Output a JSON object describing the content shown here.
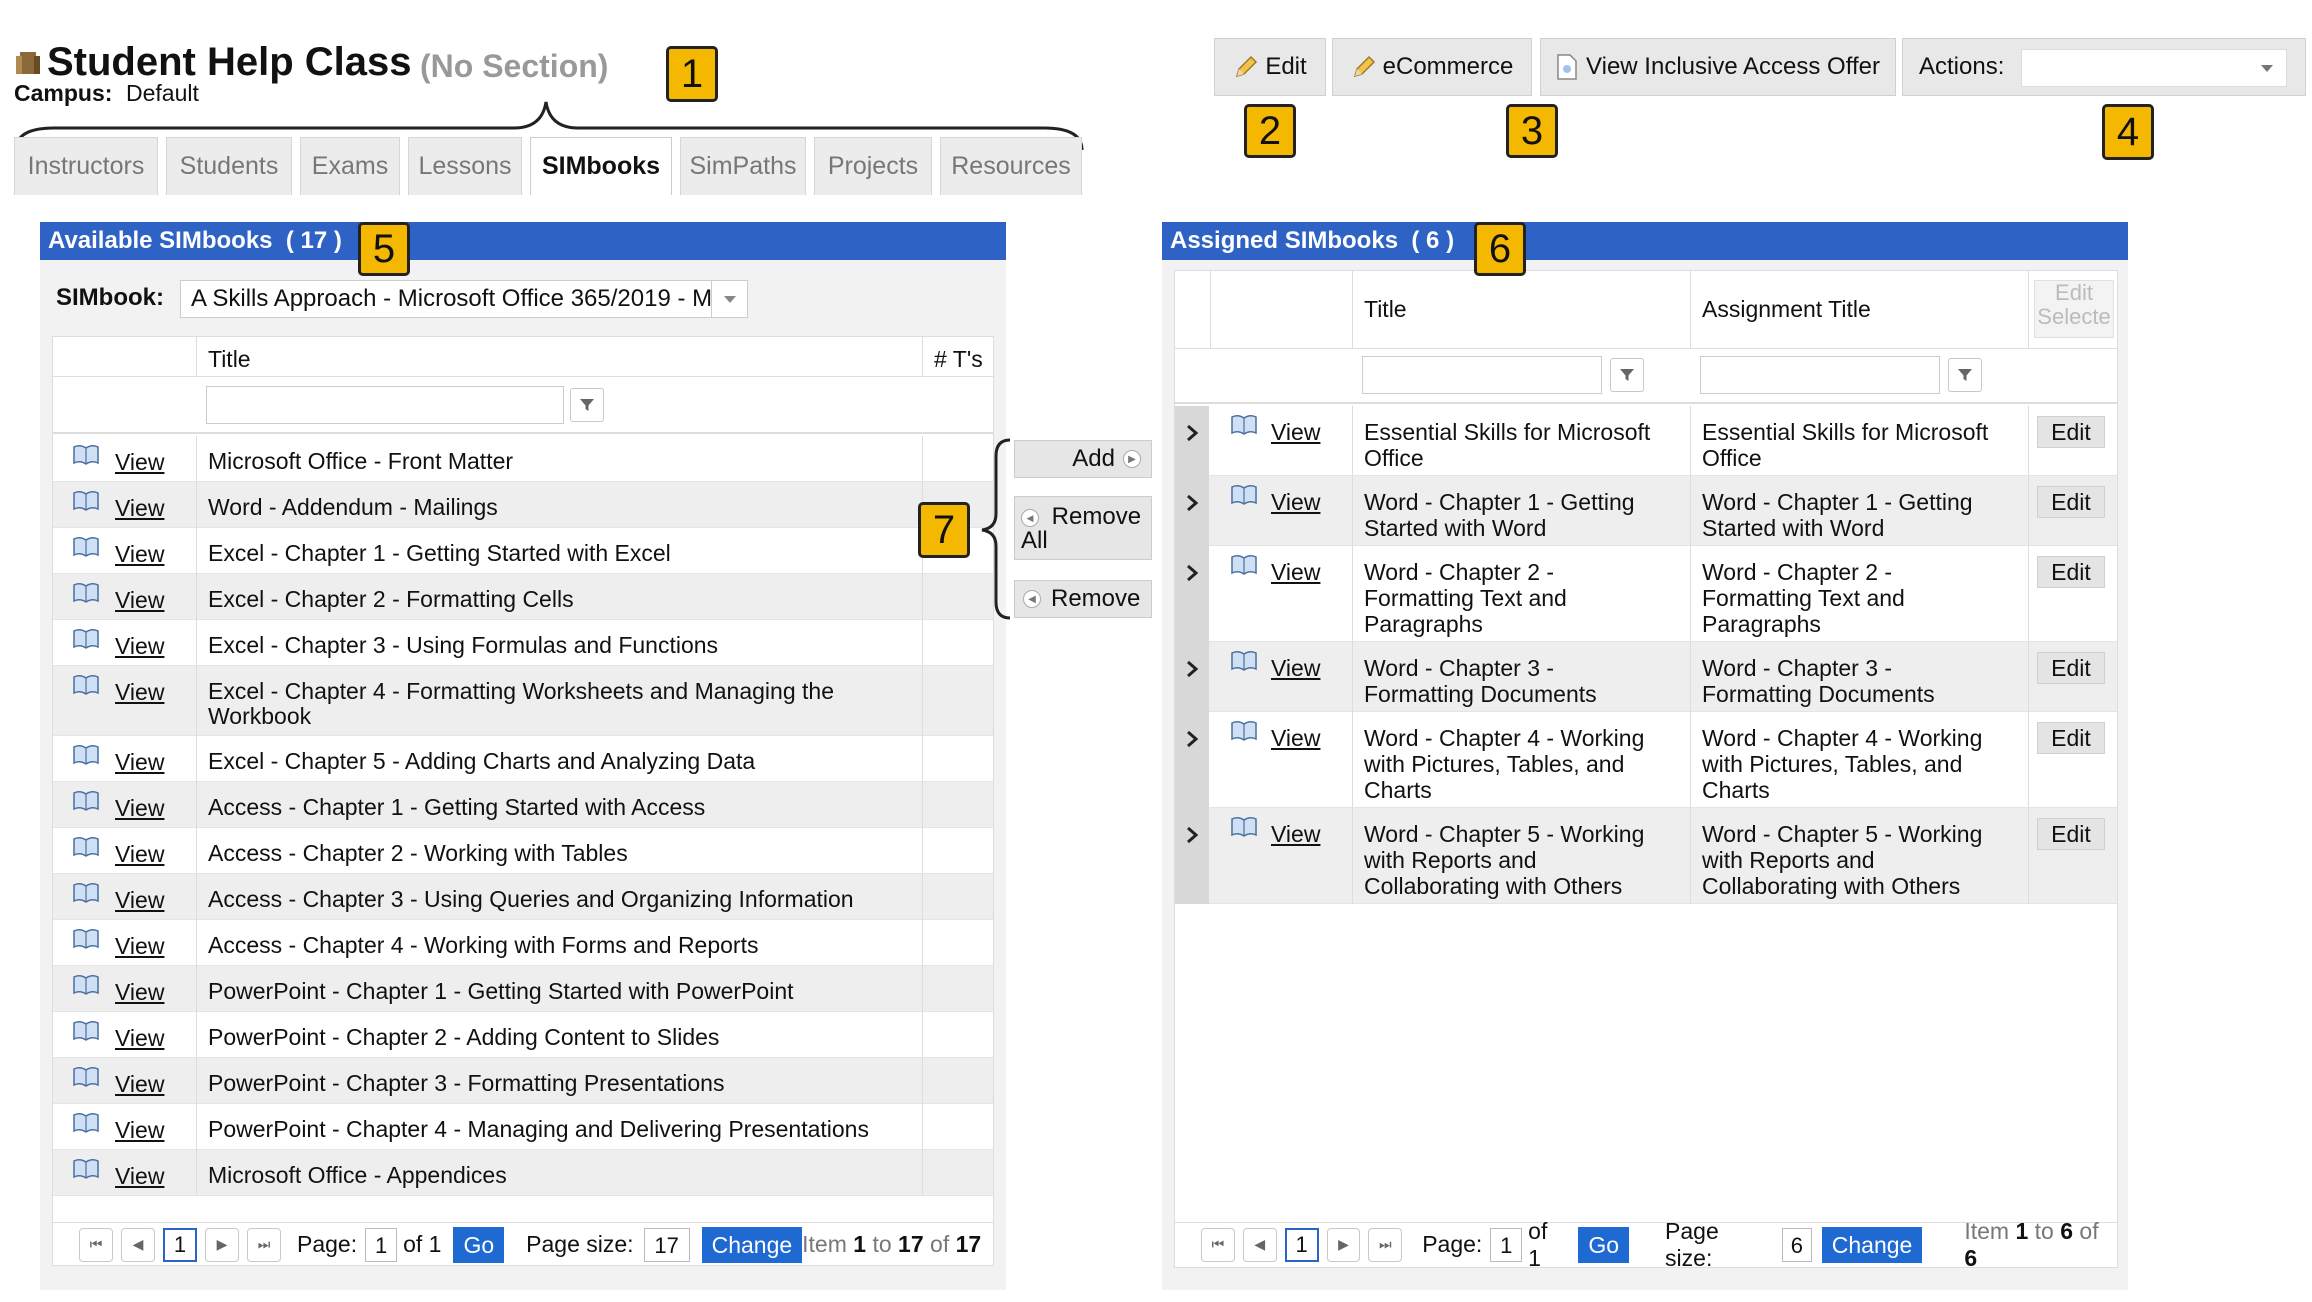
{
  "header": {
    "title": "Student Help Class",
    "section": "(No Section)",
    "campus_label": "Campus:",
    "campus_value": "Default"
  },
  "tabs": [
    {
      "label": "Instructors"
    },
    {
      "label": "Students"
    },
    {
      "label": "Exams"
    },
    {
      "label": "Lessons"
    },
    {
      "label": "SIMbooks",
      "active": true
    },
    {
      "label": "SimPaths"
    },
    {
      "label": "Projects"
    },
    {
      "label": "Resources"
    }
  ],
  "toolbar": {
    "edit_label": "Edit",
    "ecommerce_label": "eCommerce",
    "view_offer_label": "View Inclusive Access Offer",
    "actions_label": "Actions:",
    "actions_value": ""
  },
  "callouts": [
    "1",
    "2",
    "3",
    "4",
    "5",
    "6",
    "7"
  ],
  "available": {
    "header": "Available SIMbooks",
    "count": "( 17 )",
    "simbook_label": "SIMbook:",
    "simbook_value": "A Skills Approach -  Microsoft Office 365/2019 - M",
    "col_title": "Title",
    "col_ts": "# T's",
    "view_label": "View",
    "rows": [
      "Microsoft Office - Front Matter",
      "Word - Addendum - Mailings",
      "Excel - Chapter 1 - Getting Started with Excel",
      "Excel - Chapter 2 - Formatting Cells",
      "Excel - Chapter 3 - Using Formulas and Functions",
      "Excel - Chapter 4 - Formatting Worksheets and Managing the Workbook",
      "Excel - Chapter 5 - Adding Charts and Analyzing Data",
      "Access - Chapter 1 - Getting Started with Access",
      "Access - Chapter 2 - Working with Tables",
      "Access - Chapter 3 - Using Queries and Organizing Information",
      "Access - Chapter 4 - Working with Forms and Reports",
      "PowerPoint - Chapter 1 - Getting Started with PowerPoint",
      "PowerPoint - Chapter 2 - Adding Content to Slides",
      "PowerPoint - Chapter 3 - Formatting Presentations",
      "PowerPoint - Chapter 4 - Managing and Delivering Presentations",
      "Microsoft Office - Appendices"
    ],
    "pager": {
      "current": "1",
      "page_label": "Page:",
      "page_value": "1",
      "of_label": "of 1",
      "go": "Go",
      "size_label": "Page size:",
      "size_value": "17",
      "change": "Change",
      "item_prefix": "Item",
      "item_from": "1",
      "item_to_label": "to",
      "item_to": "17",
      "item_of_label": "of",
      "item_total": "17"
    }
  },
  "transfer": {
    "add": "Add",
    "remove_all_1": "Remove",
    "remove_all_2": "All",
    "remove": "Remove"
  },
  "assigned": {
    "header": "Assigned SIMbooks",
    "count": "( 6 )",
    "col_title": "Title",
    "col_assignment": "Assignment Title",
    "col_edit_1": "Edit",
    "col_edit_2": "Selecte",
    "view_label": "View",
    "edit_label": "Edit",
    "rows": [
      {
        "title": [
          "Essential Skills for Microsoft",
          "Office"
        ],
        "assignment": [
          "Essential Skills for Microsoft",
          "Office"
        ]
      },
      {
        "title": [
          "Word - Chapter 1 - Getting",
          "Started with Word"
        ],
        "assignment": [
          "Word - Chapter 1 - Getting",
          "Started with Word"
        ]
      },
      {
        "title": [
          "Word - Chapter 2 -",
          "Formatting Text and",
          "Paragraphs"
        ],
        "assignment": [
          "Word - Chapter 2 -",
          "Formatting Text and",
          "Paragraphs"
        ]
      },
      {
        "title": [
          "Word - Chapter 3 -",
          "Formatting Documents"
        ],
        "assignment": [
          "Word - Chapter 3 -",
          "Formatting Documents"
        ]
      },
      {
        "title": [
          "Word - Chapter 4 - Working",
          "with Pictures, Tables, and",
          "Charts"
        ],
        "assignment": [
          "Word - Chapter 4 - Working",
          "with Pictures, Tables, and",
          "Charts"
        ]
      },
      {
        "title": [
          "Word - Chapter 5 - Working",
          "with Reports and",
          "Collaborating with Others"
        ],
        "assignment": [
          "Word - Chapter 5 - Working",
          "with Reports and",
          "Collaborating with Others"
        ]
      }
    ],
    "pager": {
      "current": "1",
      "page_label": "Page:",
      "page_value": "1",
      "of_label": "of 1",
      "go": "Go",
      "size_label": "Page size:",
      "size_value": "6",
      "change": "Change",
      "item_prefix": "Item",
      "item_from": "1",
      "item_to_label": "to",
      "item_to": "6",
      "item_of_label": "of",
      "item_total": "6"
    }
  },
  "colors": {
    "panel_header": "#2e62c4",
    "callout": "#f5b800",
    "button_blue": "#1e6ad2"
  }
}
